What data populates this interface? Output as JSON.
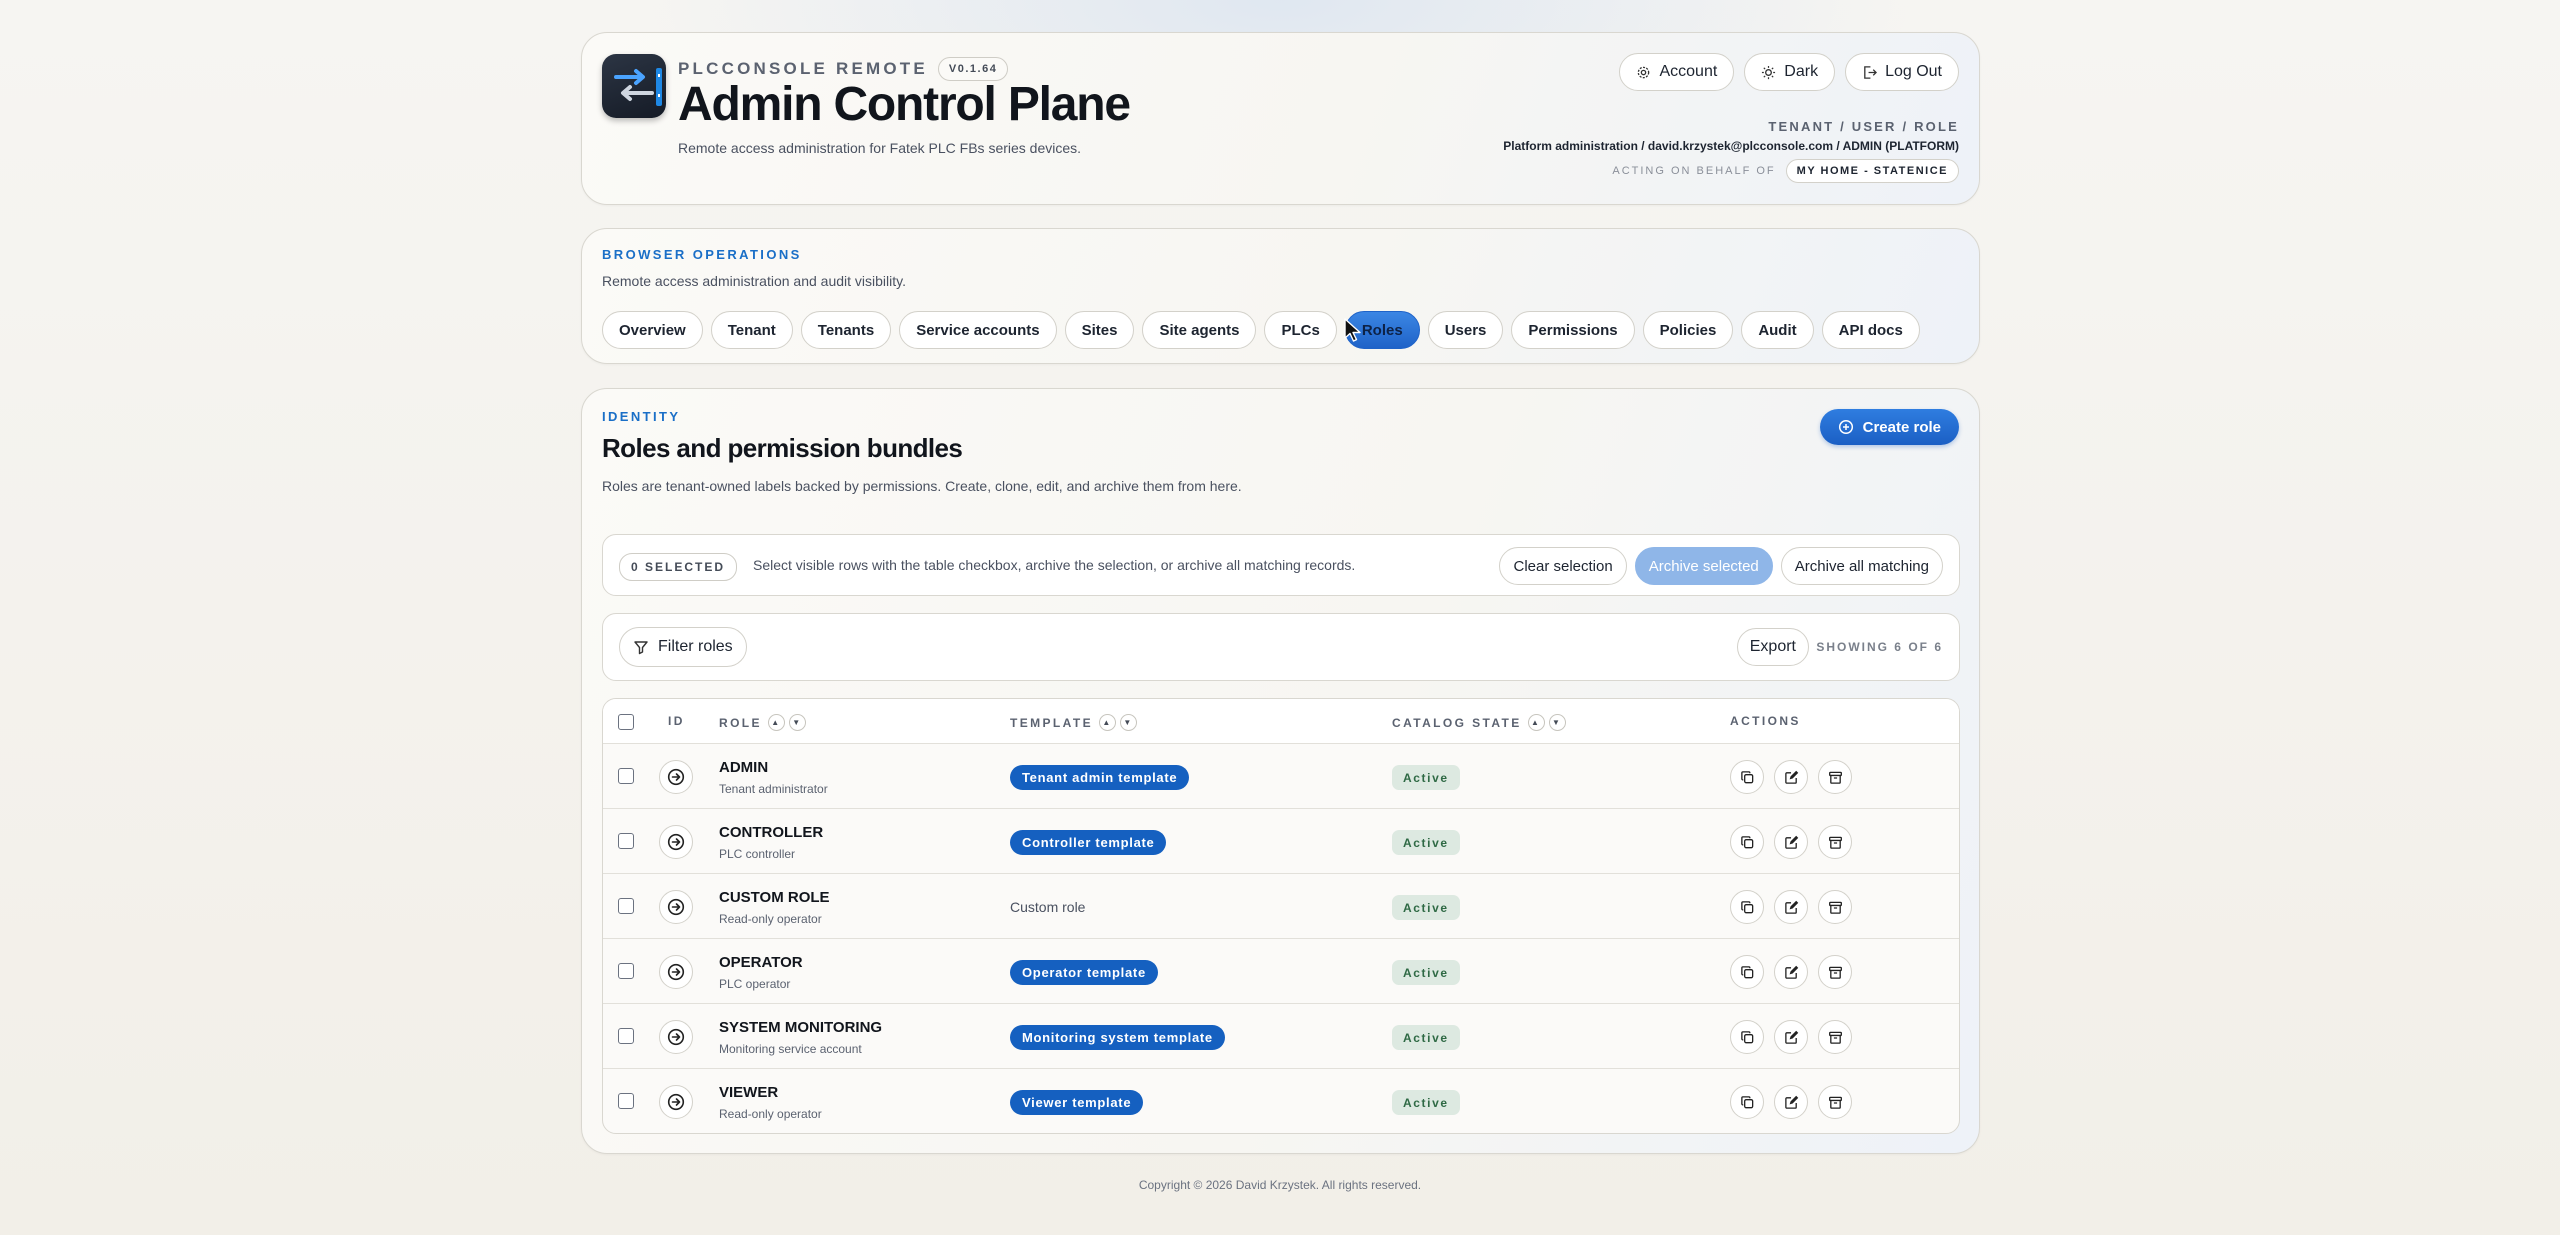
{
  "header": {
    "brand": "PLCCONSOLE REMOTE",
    "version": "V0.1.64",
    "title": "Admin Control Plane",
    "subtitle": "Remote access administration for Fatek PLC FBs series devices.",
    "buttons": {
      "account": "Account",
      "dark": "Dark",
      "logout": "Log Out"
    },
    "context_label": "TENANT / USER / ROLE",
    "context_value": "Platform administration / david.krzystek@plcconsole.com / ADMIN (PLATFORM)",
    "acting_label": "ACTING ON BEHALF OF",
    "acting_value": "MY HOME - STATENICE"
  },
  "ops": {
    "eyebrow": "BROWSER OPERATIONS",
    "description": "Remote access administration and audit visibility.",
    "tabs": [
      {
        "label": "Overview"
      },
      {
        "label": "Tenant"
      },
      {
        "label": "Tenants"
      },
      {
        "label": "Service accounts"
      },
      {
        "label": "Sites"
      },
      {
        "label": "Site agents"
      },
      {
        "label": "PLCs"
      },
      {
        "label": "Roles",
        "active": true
      },
      {
        "label": "Users"
      },
      {
        "label": "Permissions"
      },
      {
        "label": "Policies"
      },
      {
        "label": "Audit"
      },
      {
        "label": "API docs"
      }
    ]
  },
  "identity": {
    "eyebrow": "IDENTITY",
    "title": "Roles and permission bundles",
    "description": "Roles are tenant-owned labels backed by permissions. Create, clone, edit, and archive them from here.",
    "create_label": "Create role",
    "selection": {
      "badge": "0 SELECTED",
      "text": "Select visible rows with the table checkbox, archive the selection, or archive all matching records.",
      "clear": "Clear selection",
      "archive_selected": "Archive selected",
      "archive_all": "Archive all matching"
    },
    "filter_label": "Filter roles",
    "export_label": "Export",
    "showing": "SHOWING 6 OF 6",
    "columns": {
      "id": "ID",
      "role": "ROLE",
      "template": "TEMPLATE",
      "state": "CATALOG STATE",
      "actions": "ACTIONS"
    },
    "rows": [
      {
        "name": "ADMIN",
        "sub": "Tenant administrator",
        "template": "Tenant admin template",
        "template_badge": true,
        "state": "Active"
      },
      {
        "name": "CONTROLLER",
        "sub": "PLC controller",
        "template": "Controller template",
        "template_badge": true,
        "state": "Active"
      },
      {
        "name": "CUSTOM ROLE",
        "sub": "Read-only operator",
        "template": "Custom role",
        "template_badge": false,
        "state": "Active"
      },
      {
        "name": "OPERATOR",
        "sub": "PLC operator",
        "template": "Operator template",
        "template_badge": true,
        "state": "Active"
      },
      {
        "name": "SYSTEM MONITORING",
        "sub": "Monitoring service account",
        "template": "Monitoring system template",
        "template_badge": true,
        "state": "Active"
      },
      {
        "name": "VIEWER",
        "sub": "Read-only operator",
        "template": "Viewer template",
        "template_badge": true,
        "state": "Active"
      }
    ]
  },
  "footer": "Copyright © 2026 David Krzystek. All rights reserved.",
  "colors": {
    "accent": "#1b5fc4",
    "badge": "#1560c0",
    "active_state": "#dde9e1"
  }
}
